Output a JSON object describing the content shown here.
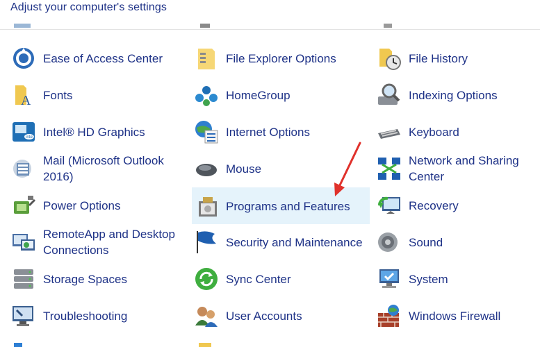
{
  "header": {
    "title": "Adjust your computer's settings"
  },
  "items": [
    {
      "label": "Ease of Access Center",
      "icon": "ease-of-access-icon"
    },
    {
      "label": "File Explorer Options",
      "icon": "folder-options-icon"
    },
    {
      "label": "File History",
      "icon": "file-history-icon"
    },
    {
      "label": "Fonts",
      "icon": "fonts-icon"
    },
    {
      "label": "HomeGroup",
      "icon": "homegroup-icon"
    },
    {
      "label": "Indexing Options",
      "icon": "indexing-icon"
    },
    {
      "label": "Intel® HD Graphics",
      "icon": "intel-graphics-icon"
    },
    {
      "label": "Internet Options",
      "icon": "internet-options-icon"
    },
    {
      "label": "Keyboard",
      "icon": "keyboard-icon"
    },
    {
      "label": "Mail (Microsoft Outlook 2016)",
      "line1": "Mail (Microsoft Outlook",
      "line2": "2016)",
      "icon": "mail-icon"
    },
    {
      "label": "Mouse",
      "icon": "mouse-icon"
    },
    {
      "label": "Network and Sharing Center",
      "line1": "Network and Sharing",
      "line2": "Center",
      "icon": "network-icon"
    },
    {
      "label": "Power Options",
      "icon": "power-icon"
    },
    {
      "label": "Programs and Features",
      "icon": "programs-icon"
    },
    {
      "label": "Recovery",
      "icon": "recovery-icon"
    },
    {
      "label": "RemoteApp and Desktop Connections",
      "line1": "RemoteApp and Desktop",
      "line2": "Connections",
      "icon": "remoteapp-icon"
    },
    {
      "label": "Security and Maintenance",
      "icon": "security-flag-icon"
    },
    {
      "label": "Sound",
      "icon": "sound-icon"
    },
    {
      "label": "Storage Spaces",
      "icon": "storage-icon"
    },
    {
      "label": "Sync Center",
      "icon": "sync-icon"
    },
    {
      "label": "System",
      "icon": "system-icon"
    },
    {
      "label": "Troubleshooting",
      "icon": "troubleshooting-icon"
    },
    {
      "label": "User Accounts",
      "icon": "user-accounts-icon"
    },
    {
      "label": "Windows Firewall",
      "icon": "firewall-icon"
    }
  ],
  "colors": {
    "link": "#1e3287",
    "selected_bg": "#e5f3fb",
    "arrow": "#e0312b"
  }
}
